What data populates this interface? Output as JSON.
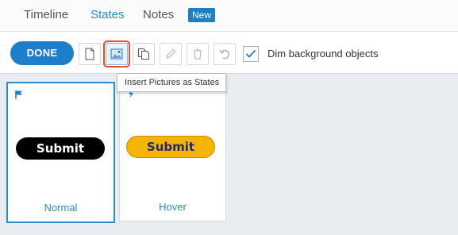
{
  "tabs": {
    "timeline": "Timeline",
    "states": "States",
    "notes": "Notes",
    "badge": "New",
    "active": "states"
  },
  "toolbar": {
    "done_label": "DONE",
    "buttons": [
      {
        "icon": "new-state-icon",
        "state": "enabled"
      },
      {
        "icon": "insert-picture-icon",
        "state": "highlighted"
      },
      {
        "icon": "duplicate-icon",
        "state": "enabled"
      },
      {
        "icon": "pencil-icon",
        "state": "disabled"
      },
      {
        "icon": "trash-icon",
        "state": "disabled"
      },
      {
        "icon": "reset-icon",
        "state": "disabled"
      }
    ],
    "dim_checked": true,
    "dim_label": "Dim background objects"
  },
  "tooltip": {
    "text": "Insert Pictures as States"
  },
  "states": [
    {
      "name": "Normal",
      "selected": true,
      "marker": "flag-icon",
      "preview_text": "Submit",
      "preview_color": "#000000",
      "preview_text_color": "#ffffff"
    },
    {
      "name": "Hover",
      "selected": false,
      "marker": "lightning-icon",
      "preview_text": "Submit",
      "preview_color": "#f5b400",
      "preview_text_color": "#1e2a80"
    }
  ],
  "colors": {
    "accent": "#2a8bd0",
    "done_bg": "#1d7fcb",
    "highlight_outline": "#e0502a",
    "stage_bg": "#e9edf1"
  }
}
